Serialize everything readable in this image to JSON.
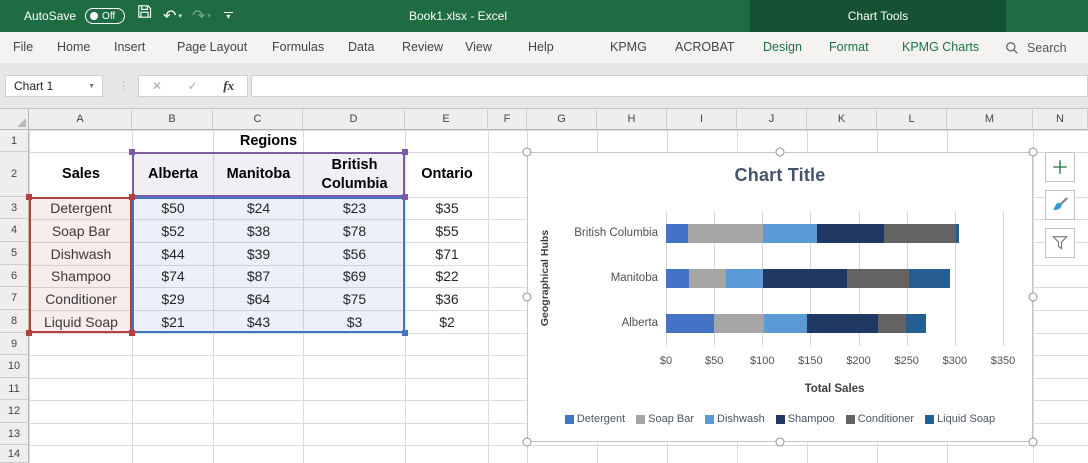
{
  "titlebar": {
    "autosave_label": "AutoSave",
    "autosave_state": "Off",
    "title": "Book1.xlsx  -  Excel",
    "context_tab": "Chart Tools"
  },
  "ribbon": {
    "tabs": [
      {
        "label": "File",
        "green": false
      },
      {
        "label": "Home",
        "green": false
      },
      {
        "label": "Insert",
        "green": false
      },
      {
        "label": "Page Layout",
        "green": false
      },
      {
        "label": "Formulas",
        "green": false
      },
      {
        "label": "Data",
        "green": false
      },
      {
        "label": "Review",
        "green": false
      },
      {
        "label": "View",
        "green": false
      },
      {
        "label": "Help",
        "green": false
      },
      {
        "label": "KPMG",
        "green": false
      },
      {
        "label": "ACROBAT",
        "green": false
      },
      {
        "label": "Design",
        "green": true
      },
      {
        "label": "Format",
        "green": true
      },
      {
        "label": "KPMG Charts",
        "green": true
      }
    ],
    "search_label": "Search"
  },
  "formula_bar": {
    "name_box": "Chart 1",
    "fx_label": "fx"
  },
  "sheet": {
    "col_headers": [
      "A",
      "B",
      "C",
      "D",
      "E",
      "F",
      "G",
      "H",
      "I",
      "J",
      "K",
      "L",
      "M",
      "N"
    ],
    "row_headers": [
      "1",
      "2",
      "3",
      "4",
      "5",
      "6",
      "7",
      "8",
      "9",
      "10",
      "11",
      "12",
      "13",
      "14"
    ],
    "table": {
      "regions_label": "Regions",
      "header_row": [
        "Sales",
        "Alberta",
        "Manitoba",
        "British Columbia",
        "Ontario"
      ],
      "rows": [
        {
          "label": "Detergent",
          "values": [
            "$50",
            "$24",
            "$23",
            "$35"
          ]
        },
        {
          "label": "Soap Bar",
          "values": [
            "$52",
            "$38",
            "$78",
            "$55"
          ]
        },
        {
          "label": "Dishwash",
          "values": [
            "$44",
            "$39",
            "$56",
            "$71"
          ]
        },
        {
          "label": "Shampoo",
          "values": [
            "$74",
            "$87",
            "$69",
            "$22"
          ]
        },
        {
          "label": "Conditioner",
          "values": [
            "$29",
            "$64",
            "$75",
            "$36"
          ]
        },
        {
          "label": "Liquid Soap",
          "values": [
            "$21",
            "$43",
            "$3",
            "$2"
          ]
        }
      ]
    },
    "highlight_colors": {
      "headers": "#7B5BA3",
      "categories": "#B4403D",
      "values": "#4472C4"
    }
  },
  "chart_data": {
    "type": "bar",
    "stacked": true,
    "orientation": "horizontal",
    "title": "Chart Title",
    "categories": [
      "British Columbia",
      "Manitoba",
      "Alberta"
    ],
    "series": [
      {
        "name": "Detergent",
        "color": "#4472C4",
        "values": [
          23,
          24,
          50
        ]
      },
      {
        "name": "Soap Bar",
        "color": "#A5A5A5",
        "values": [
          78,
          38,
          52
        ]
      },
      {
        "name": "Dishwash",
        "color": "#5B9BD5",
        "values": [
          56,
          39,
          44
        ]
      },
      {
        "name": "Shampoo",
        "color": "#1F3864",
        "values": [
          69,
          87,
          74
        ]
      },
      {
        "name": "Conditioner",
        "color": "#636363",
        "values": [
          75,
          64,
          29
        ]
      },
      {
        "name": "Liquid Soap",
        "color": "#255E91",
        "values": [
          3,
          43,
          21
        ]
      }
    ],
    "xlabel": "Total Sales",
    "ylabel": "Geographical Hubs",
    "x_ticks": [
      "$0",
      "$50",
      "$100",
      "$150",
      "$200",
      "$250",
      "$300",
      "$350"
    ],
    "xlim": [
      0,
      350
    ],
    "legend_position": "bottom",
    "gridlines": true
  }
}
